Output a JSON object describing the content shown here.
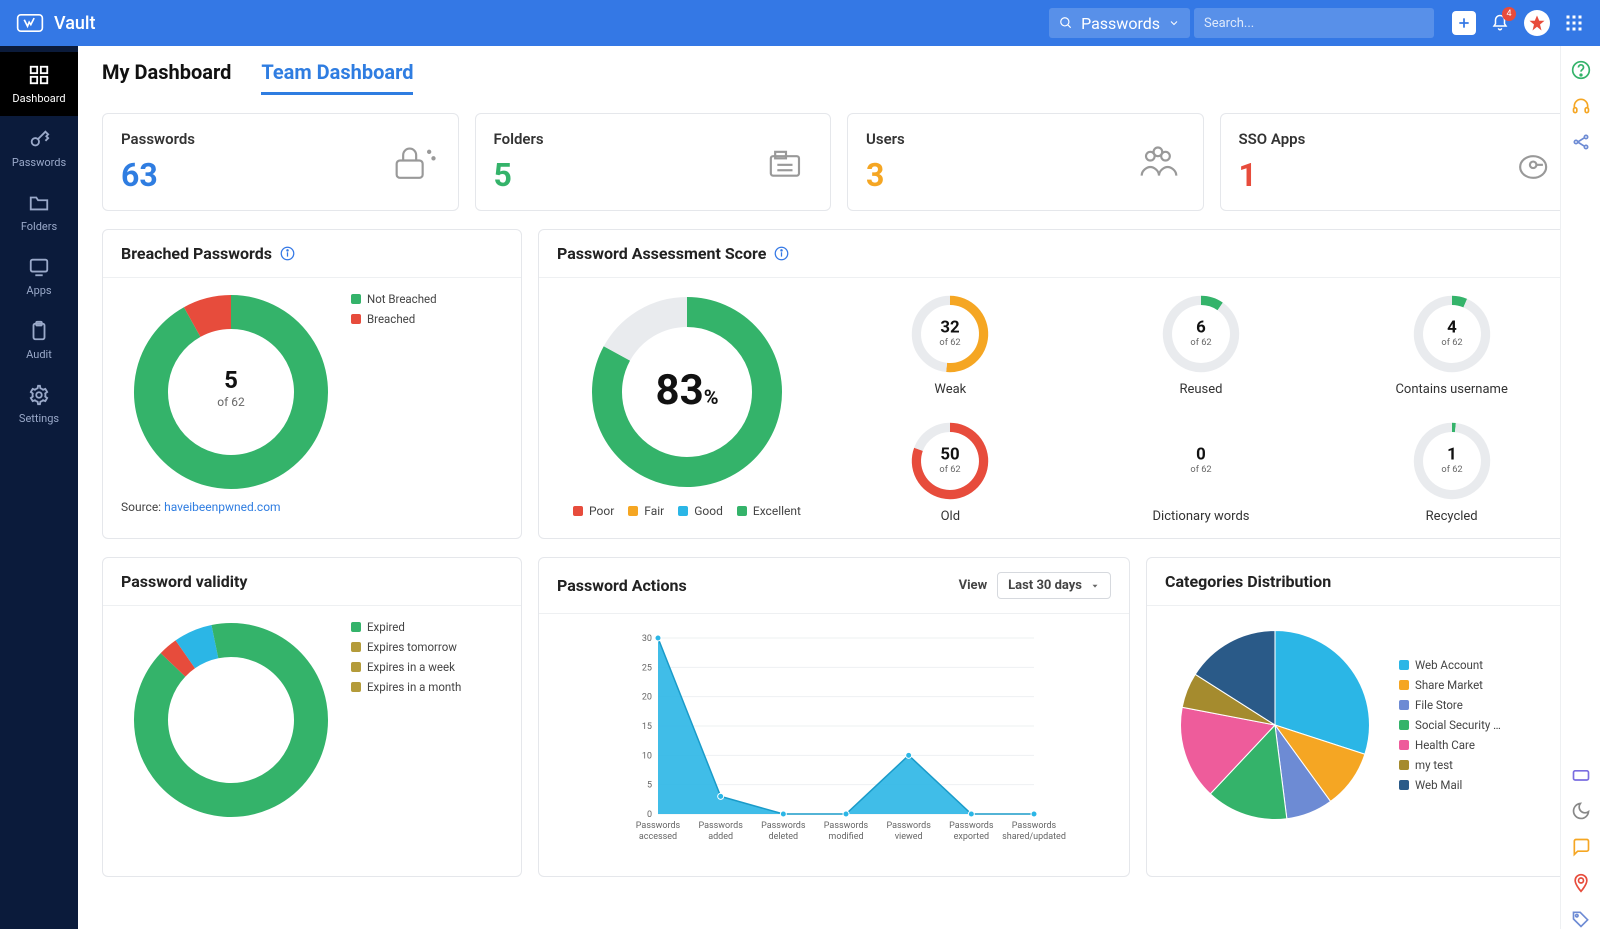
{
  "app": {
    "name": "Vault"
  },
  "topbar": {
    "selector": {
      "label": "Passwords"
    },
    "search": {
      "placeholder": "Search..."
    },
    "notification_count": "4"
  },
  "sidebar": {
    "items": [
      {
        "label": "Dashboard"
      },
      {
        "label": "Passwords"
      },
      {
        "label": "Folders"
      },
      {
        "label": "Apps"
      },
      {
        "label": "Audit"
      },
      {
        "label": "Settings"
      }
    ]
  },
  "tabs": [
    {
      "label": "My Dashboard"
    },
    {
      "label": "Team Dashboard"
    }
  ],
  "summary": [
    {
      "label": "Passwords",
      "value": "63",
      "color": "#2f7de1"
    },
    {
      "label": "Folders",
      "value": "5",
      "color": "#34b36a"
    },
    {
      "label": "Users",
      "value": "3",
      "color": "#f5a623"
    },
    {
      "label": "SSO Apps",
      "value": "1",
      "color": "#e74c3c"
    }
  ],
  "breached": {
    "title": "Breached Passwords",
    "center_value": "5",
    "center_sub": "of 62",
    "source_prefix": "Source: ",
    "source_link": "haveibeenpwned.com",
    "legend": [
      {
        "label": "Not Breached",
        "color": "#34b36a"
      },
      {
        "label": "Breached",
        "color": "#e74c3c"
      }
    ]
  },
  "assessment": {
    "title": "Password Assessment Score",
    "score_value": "83",
    "score_unit": "%",
    "legend": [
      {
        "label": "Poor",
        "color": "#e74c3c"
      },
      {
        "label": "Fair",
        "color": "#f5a623"
      },
      {
        "label": "Good",
        "color": "#2bb6e6"
      },
      {
        "label": "Excellent",
        "color": "#34b36a"
      }
    ],
    "metrics": [
      {
        "label": "Weak",
        "value": "32",
        "sub": "of 62",
        "color": "#f5a623"
      },
      {
        "label": "Reused",
        "value": "6",
        "sub": "of 62",
        "color": "#34b36a"
      },
      {
        "label": "Contains username",
        "value": "4",
        "sub": "of 62",
        "color": "#34b36a"
      },
      {
        "label": "Old",
        "value": "50",
        "sub": "of 62",
        "color": "#e74c3c"
      },
      {
        "label": "Dictionary words",
        "value": "0",
        "sub": "of 62",
        "color": "#34b36a"
      },
      {
        "label": "Recycled",
        "value": "1",
        "sub": "of 62",
        "color": "#34b36a"
      }
    ]
  },
  "validity": {
    "title": "Password validity",
    "legend": [
      {
        "label": "Expired",
        "color": "#34b36a"
      },
      {
        "label": "Expires tomorrow",
        "color": "#b49b3a"
      },
      {
        "label": "Expires in a week",
        "color": "#b49b3a"
      },
      {
        "label": "Expires in a month",
        "color": "#b49b3a"
      }
    ]
  },
  "actions": {
    "title": "Password Actions",
    "view_label": "View",
    "range_label": "Last 30 days"
  },
  "dist": {
    "title": "Categories Distribution",
    "legend": [
      {
        "label": "Web Account",
        "color": "#2bb6e6"
      },
      {
        "label": "Share Market",
        "color": "#f5a623"
      },
      {
        "label": "File Store",
        "color": "#6d8bd4"
      },
      {
        "label": "Social Security …",
        "color": "#34b36a"
      },
      {
        "label": "Health Care",
        "color": "#ee5c9b"
      },
      {
        "label": "my test",
        "color": "#a58b2e"
      },
      {
        "label": "Web Mail",
        "color": "#2a5a88"
      }
    ]
  },
  "chart_data": [
    {
      "type": "donut",
      "title": "Breached Passwords",
      "total": 62,
      "series": [
        {
          "name": "Not Breached",
          "value": 57
        },
        {
          "name": "Breached",
          "value": 5
        }
      ]
    },
    {
      "type": "donut",
      "title": "Password Assessment Score",
      "value_pct": 83,
      "legend": [
        "Poor",
        "Fair",
        "Good",
        "Excellent"
      ]
    },
    {
      "type": "donut",
      "title": "Password validity",
      "series": [
        {
          "name": "Expired",
          "value": 54
        },
        {
          "name": "Expires tomorrow",
          "value": 2
        },
        {
          "name": "Expires in a week",
          "value": 4
        },
        {
          "name": "Expires in a month",
          "value": 2
        }
      ]
    },
    {
      "type": "area",
      "title": "Password Actions",
      "ylim": [
        0,
        30
      ],
      "yticks": [
        0,
        5,
        10,
        15,
        20,
        25,
        30
      ],
      "categories": [
        "Passwords accessed",
        "Passwords added",
        "Passwords deleted",
        "Passwords modified",
        "Passwords viewed",
        "Passwords exported",
        "Passwords shared/updated"
      ],
      "values": [
        30,
        3,
        0,
        0,
        10,
        0,
        0
      ]
    },
    {
      "type": "pie",
      "title": "Categories Distribution",
      "series": [
        {
          "name": "Web Account",
          "value": 30
        },
        {
          "name": "Share Market",
          "value": 10
        },
        {
          "name": "File Store",
          "value": 8
        },
        {
          "name": "Social Security …",
          "value": 14
        },
        {
          "name": "Health Care",
          "value": 16
        },
        {
          "name": "my test",
          "value": 6
        },
        {
          "name": "Web Mail",
          "value": 16
        }
      ]
    }
  ]
}
